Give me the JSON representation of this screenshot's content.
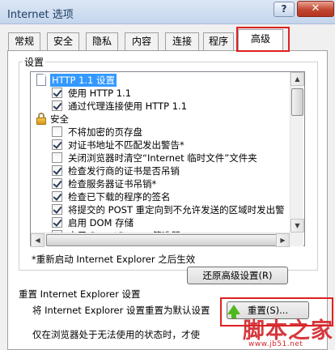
{
  "window": {
    "title": "Internet 选项",
    "help_label": "?",
    "close_label": "✕"
  },
  "tabs": [
    {
      "label": "常规",
      "active": false
    },
    {
      "label": "安全",
      "active": false
    },
    {
      "label": "隐私",
      "active": false
    },
    {
      "label": "内容",
      "active": false
    },
    {
      "label": "连接",
      "active": false
    },
    {
      "label": "程序",
      "active": false
    },
    {
      "label": "高级",
      "active": true
    }
  ],
  "settings": {
    "group_label": "设置",
    "items": [
      {
        "type": "category",
        "icon": "document-icon",
        "label": "HTTP 1.1 设置",
        "selected": true
      },
      {
        "type": "checkbox",
        "checked": true,
        "label": "使用 HTTP 1.1"
      },
      {
        "type": "checkbox",
        "checked": true,
        "label": "通过代理连接使用 HTTP 1.1"
      },
      {
        "type": "category",
        "icon": "lock-icon",
        "label": "安全",
        "selected": false
      },
      {
        "type": "checkbox",
        "checked": false,
        "label": "不将加密的页存盘"
      },
      {
        "type": "checkbox",
        "checked": true,
        "label": "对证书地址不匹配发出警告*"
      },
      {
        "type": "checkbox",
        "checked": false,
        "label": "关闭浏览器时清空“Internet 临时文件”文件夹"
      },
      {
        "type": "checkbox",
        "checked": true,
        "label": "检查发行商的证书是否吊销"
      },
      {
        "type": "checkbox",
        "checked": true,
        "label": "检查服务器证书吊销*"
      },
      {
        "type": "checkbox",
        "checked": true,
        "label": "检查已下载的程序的签名"
      },
      {
        "type": "checkbox",
        "checked": true,
        "label": "将提交的 POST 重定向到不允许发送的区域时发出警"
      },
      {
        "type": "checkbox",
        "checked": true,
        "label": "启用 DOM 存储"
      },
      {
        "type": "checkbox",
        "checked": false,
        "label": "启用 SmartScreen 筛选器"
      }
    ],
    "restart_note": "*重新启动 Internet Explorer 之后生效",
    "restore_button": "还原高级设置(R)"
  },
  "reset": {
    "heading": "重置 Internet Explorer 设置",
    "description": "将 Internet Explorer 设置重置为默认设置",
    "button": "重置(S)...",
    "note": "仅在浏览器处于无法使用的状态时，才使"
  },
  "watermark": {
    "text": "脚本之家",
    "url": "www.jb51.net"
  },
  "colors": {
    "highlight_red": "#e02020",
    "selection_blue": "#3399ff",
    "arrow_green": "#4fb81d"
  }
}
